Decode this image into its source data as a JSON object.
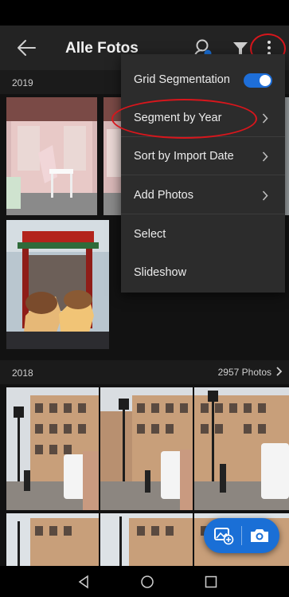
{
  "app_bar": {
    "title": "Alle Fotos",
    "back_icon": "arrow-left-icon",
    "people_icon": "people-search-icon",
    "filter_icon": "filter-icon",
    "more_icon": "more-vertical-icon"
  },
  "sections": [
    {
      "year": "2019",
      "count": ""
    },
    {
      "year": "2018",
      "count": "2957 Photos"
    }
  ],
  "menu": {
    "items": [
      {
        "label": "Grid Segmentation",
        "type": "toggle",
        "value": true
      },
      {
        "label": "Segment by Year",
        "type": "submenu"
      },
      {
        "label": "Sort by Import Date",
        "type": "submenu"
      },
      {
        "label": "Add Photos",
        "type": "submenu"
      },
      {
        "label": "Select",
        "type": "action"
      },
      {
        "label": "Slideshow",
        "type": "action"
      }
    ]
  },
  "fab": {
    "add_icon": "add-photo-icon",
    "camera_icon": "camera-icon"
  },
  "nav": {
    "back_icon": "nav-back-icon",
    "home_icon": "nav-home-icon",
    "recents_icon": "nav-recents-icon"
  },
  "colors": {
    "accent": "#1a6fd6",
    "annotation": "#d8161c",
    "toolbar": "#232323",
    "menu": "#2c2c2c"
  }
}
